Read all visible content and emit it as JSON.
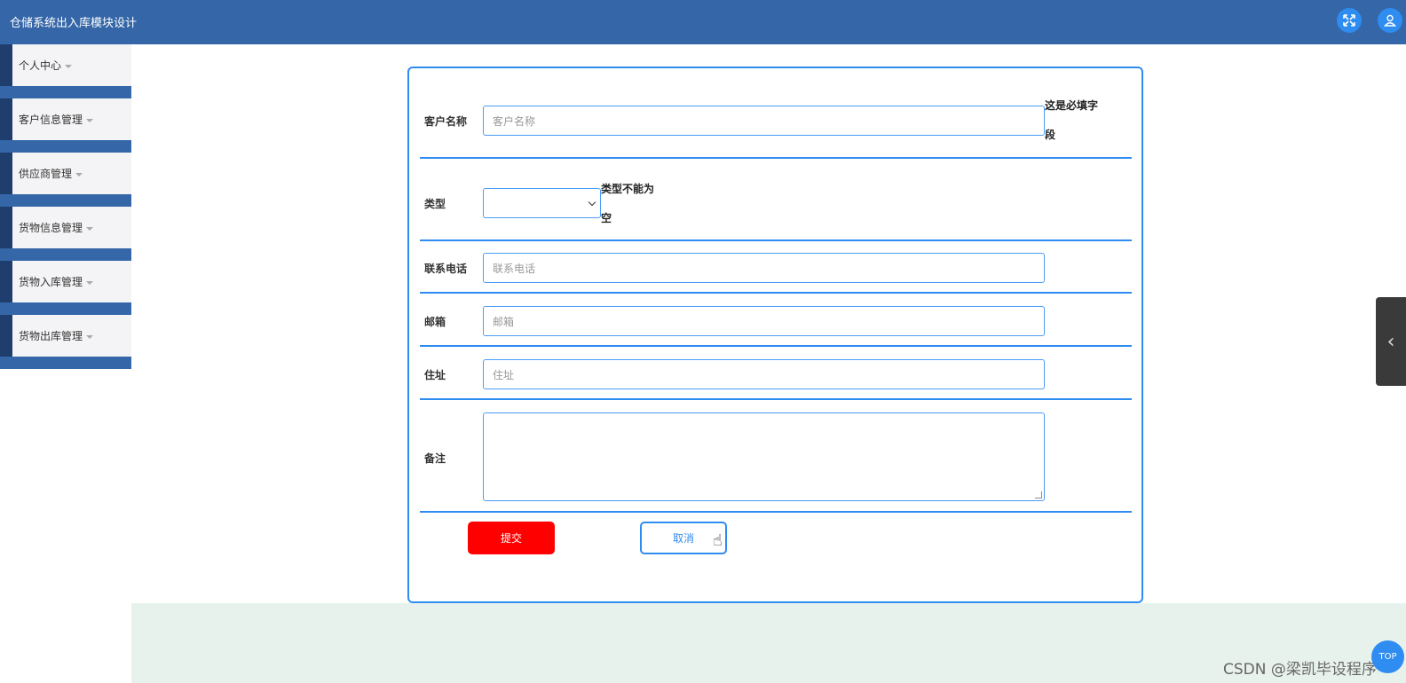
{
  "header": {
    "title": "仓储系统出入库模块设计",
    "icons": [
      "expand-icon",
      "user-icon"
    ]
  },
  "sidebar": {
    "items": [
      {
        "label": "个人中心"
      },
      {
        "label": "客户信息管理"
      },
      {
        "label": "供应商管理"
      },
      {
        "label": "货物信息管理"
      },
      {
        "label": "货物入库管理"
      },
      {
        "label": "货物出库管理"
      }
    ]
  },
  "form": {
    "customer_name": {
      "label": "客户名称",
      "placeholder": "客户名称",
      "error_line1": "这是必填字",
      "error_line2": "段"
    },
    "type": {
      "label": "类型",
      "value": "",
      "error_line1": "类型不能为",
      "error_line2": "空"
    },
    "phone": {
      "label": "联系电话",
      "placeholder": "联系电话"
    },
    "email": {
      "label": "邮箱",
      "placeholder": "邮箱"
    },
    "address": {
      "label": "住址",
      "placeholder": "住址"
    },
    "remark": {
      "label": "备注",
      "value": ""
    },
    "submit_label": "提交",
    "cancel_label": "取消"
  },
  "float_button": {
    "label": "TOP"
  },
  "watermark": "CSDN @梁凯毕设程序",
  "colors": {
    "header": "#3566a8",
    "accent": "#2f8cf0",
    "submit": "#ff0000",
    "footer_bg": "#e7f2ec"
  }
}
